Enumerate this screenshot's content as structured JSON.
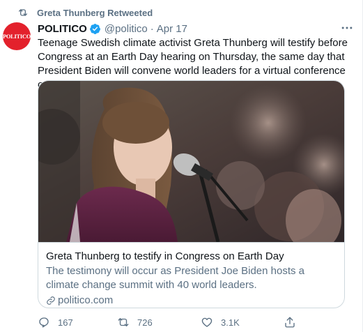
{
  "retweet_banner": {
    "label": "Greta Thunberg Retweeted"
  },
  "author": {
    "avatar_text": "POLITICO",
    "name": "POLITICO",
    "handle": "@politico",
    "separator": "·",
    "date": "Apr 17",
    "verified": true
  },
  "tweet": {
    "text": "Teenage Swedish climate activist Greta Thunberg will testify before Congress at an Earth Day hearing on Thursday, the same day that President Biden will convene world leaders for a virtual conference on climate change."
  },
  "card": {
    "title": "Greta Thunberg to testify in Congress on Earth Day",
    "description": "The testimony will occur as President Joe Biden hosts a climate change summit with 40 world leaders.",
    "domain": "politico.com"
  },
  "actions": {
    "reply_count": "167",
    "retweet_count": "726",
    "like_count": "3.1K"
  },
  "colors": {
    "accent": "#1da1f2",
    "secondary_text": "#5b7083",
    "politico_red": "#e3212c",
    "border": "#cfd9de"
  },
  "icons": [
    "retweet-icon",
    "verified-badge-icon",
    "more-icon",
    "link-icon",
    "reply-icon",
    "like-icon",
    "share-icon"
  ]
}
